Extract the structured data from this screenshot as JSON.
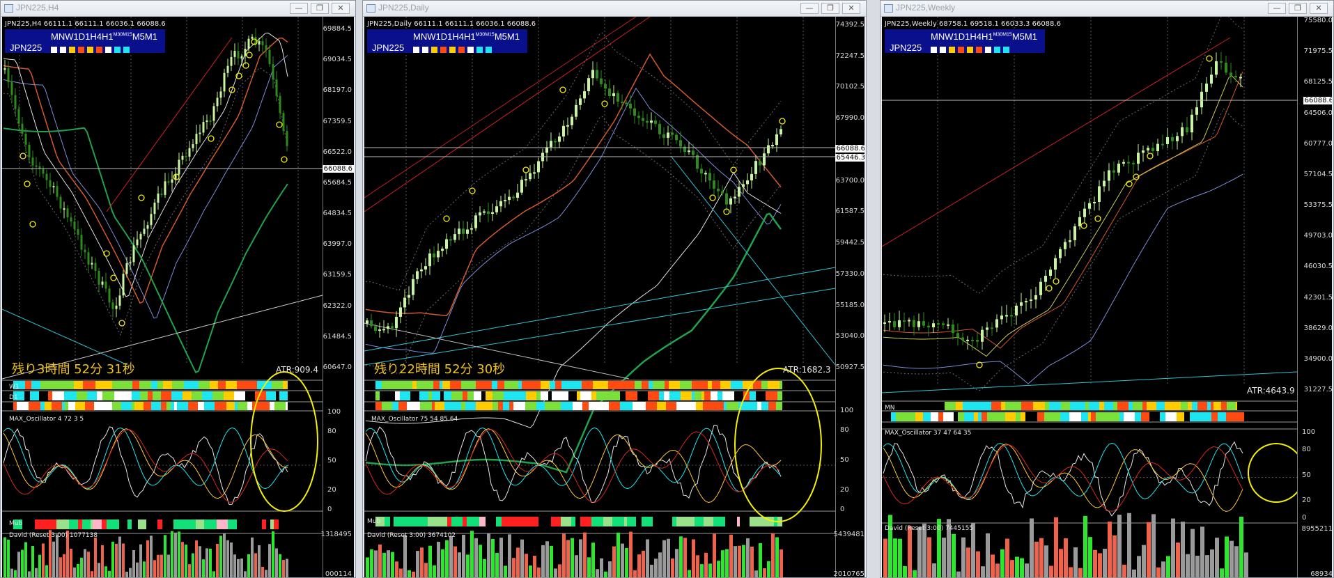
{
  "windows": [
    {
      "title": "JPN225,H4",
      "symbol_info": "JPN225,H4  66111.1 66111.1 66036.1 66088.6",
      "tf_labels": "MNW1D1H4H1",
      "tf_sup": "M30M15",
      "tf_tail": "M5M1",
      "name": "JPN225",
      "price_ticks": [
        "69884.5",
        "69034.5",
        "68197.0",
        "67359.5",
        "66522.0",
        "65684.5",
        "64834.5",
        "63997.0",
        "63159.5",
        "62322.0",
        "61484.5",
        "60647.0"
      ],
      "current_price": "66088.6",
      "remaining": "残り3時間 52分 31秒",
      "atr": "ATR:909.4",
      "strip_labels": [
        "W1",
        "D1"
      ],
      "osc_label": "MAX_Oscillator 4 72 3 5",
      "osc_ticks": [
        "100",
        "80",
        "50",
        "20",
        "0"
      ],
      "mub_label": "Mub",
      "david_label": "David (Reset 3:00) 1077138",
      "david_ticks": [
        "1318495",
        "000114"
      ]
    },
    {
      "title": "JPN225,Daily",
      "symbol_info": "JPN225,Daily  66111.1 66111.1 66036.1 66088.6",
      "tf_labels": "MNW1D1H4H1",
      "tf_sup": "M30M15",
      "tf_tail": "M5M1",
      "name": "JPN225",
      "price_ticks": [
        "74392.5",
        "72247.5",
        "70102.5",
        "67990.0",
        "65845.0",
        "63700.0",
        "61587.5",
        "59442.5",
        "57330.0",
        "55185.0",
        "53040.0",
        "50927.5"
      ],
      "current_price": "66088.6",
      "second_price": "65446.3",
      "remaining": "残り22時間 52分 30秒",
      "atr": "ATR:1682.3",
      "osc_label": "MAX_Oscillator 75 54 85 64",
      "osc_ticks": [
        "100",
        "80",
        "50",
        "20",
        "0"
      ],
      "mub_label": "Mub",
      "david_label": "David (Reset 3:00) 3674102",
      "david_ticks": [
        "5439481",
        "2010765"
      ]
    },
    {
      "title": "JPN225,Weekly",
      "symbol_info": "JPN225,Weekly  68758.1 69518.1 66033.3 66088.6",
      "tf_labels": "MNW1D1H4H1",
      "tf_sup": "M30M15",
      "tf_tail": "M5M1",
      "name": "JPN225",
      "price_ticks": [
        "75580.0",
        "71975.5",
        "68125.5",
        "64506.0",
        "60777.0",
        "57104.5",
        "53375.5",
        "49703.0",
        "46030.5",
        "42301.5",
        "38629.0",
        "34900.0",
        "31227.5"
      ],
      "current_price": "66088.6",
      "atr": "ATR:4643.9",
      "strip_labels": [
        "MN"
      ],
      "osc_label": "MAX_Oscillator 37 47 64 35",
      "osc_ticks": [
        "100",
        "80",
        "50",
        "20",
        "0"
      ],
      "david_label": "David (Reset 3:00) 7445155",
      "david_ticks": [
        "8955211",
        "68934"
      ]
    }
  ],
  "window_buttons": [
    "—",
    "❐",
    "✕"
  ],
  "colors": {
    "bull": "#c8f5a0",
    "bear": "#2d8a1d",
    "tf_box": "#0a0f8c",
    "highlight": "#f5f000",
    "remain_text": "#f0c21a",
    "strip_cyan": "#1ee6f0",
    "strip_orange": "#ff4a12",
    "strip_yellow": "#ffcc00",
    "strip_green": "#7be03a",
    "vol_red": "#f0624a",
    "vol_green": "#2ee62e",
    "vol_grey": "#9a9a9a"
  },
  "icons": {
    "window": "window-icon",
    "minimize": "minimize-icon",
    "maximize": "maximize-icon",
    "close": "close-icon"
  }
}
